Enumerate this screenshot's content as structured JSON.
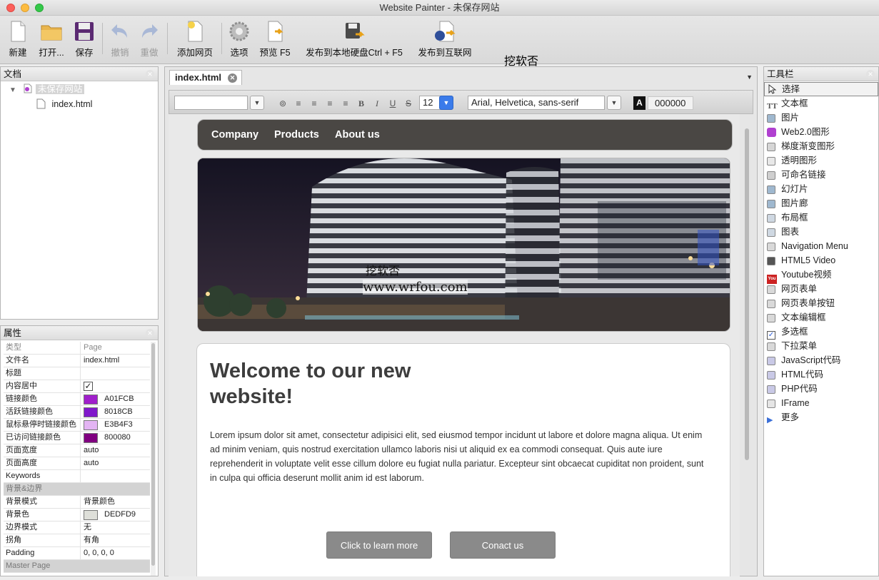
{
  "window": {
    "title": "Website Painter - 未保存网站"
  },
  "toolbar": [
    {
      "id": "new",
      "label": "新建",
      "icon": "new-file-icon",
      "disabled": false
    },
    {
      "id": "open",
      "label": "打开...",
      "icon": "folder-icon",
      "disabled": false
    },
    {
      "id": "save",
      "label": "保存",
      "icon": "floppy-disk-icon",
      "disabled": false
    },
    {
      "id": "undo",
      "label": "撤销",
      "icon": "undo-icon",
      "disabled": true
    },
    {
      "id": "redo",
      "label": "重做",
      "icon": "redo-icon",
      "disabled": true
    },
    {
      "id": "add-page",
      "label": "添加网页",
      "icon": "add-page-icon",
      "disabled": false
    },
    {
      "id": "options",
      "label": "选项",
      "icon": "gear-icon",
      "disabled": false
    },
    {
      "id": "preview",
      "label": "预览 F5",
      "icon": "preview-icon",
      "disabled": false
    },
    {
      "id": "publish-local",
      "label": "发布到本地硬盘Ctrl + F5",
      "icon": "publish-disk-icon",
      "disabled": false
    },
    {
      "id": "publish-web",
      "label": "发布到互联网",
      "icon": "publish-web-icon",
      "disabled": false
    }
  ],
  "documents": {
    "title": "文档",
    "site_name": "未保存网站",
    "pages": [
      "index.html"
    ]
  },
  "properties": {
    "title": "属性",
    "rows": [
      {
        "key": "类型",
        "value": "Page",
        "type": "dim"
      },
      {
        "key": "文件名",
        "value": "index.html",
        "type": "text"
      },
      {
        "key": "标题",
        "value": "",
        "type": "text"
      },
      {
        "key": "内容居中",
        "value": "✓",
        "type": "check"
      },
      {
        "key": "链接颜色",
        "value": "A01FCB",
        "type": "color",
        "color": "#A01FCB"
      },
      {
        "key": "活跃链接颜色",
        "value": "8018CB",
        "type": "color",
        "color": "#8018CB"
      },
      {
        "key": "鼠标悬停时链接颜色",
        "value": "E3B4F3",
        "type": "color",
        "color": "#E3B4F3"
      },
      {
        "key": "已访问链接颜色",
        "value": "800080",
        "type": "color",
        "color": "#800080"
      },
      {
        "key": "页面宽度",
        "value": "auto",
        "type": "text"
      },
      {
        "key": "页面高度",
        "value": "auto",
        "type": "text"
      },
      {
        "key": "Keywords",
        "value": "",
        "type": "text"
      },
      {
        "key": "背景&边界",
        "value": "",
        "type": "section"
      },
      {
        "key": "背景模式",
        "value": "背景颜色",
        "type": "text"
      },
      {
        "key": "背景色",
        "value": "DEDFD9",
        "type": "color",
        "color": "#DEDFD9"
      },
      {
        "key": "边界模式",
        "value": "无",
        "type": "text"
      },
      {
        "key": "拐角",
        "value": "有角",
        "type": "text"
      },
      {
        "key": "Padding",
        "value": "0, 0, 0, 0",
        "type": "text"
      },
      {
        "key": "Master Page",
        "value": "",
        "type": "section"
      }
    ]
  },
  "editor": {
    "tab_label": "index.html",
    "format_bar": {
      "font_size": "12",
      "font_family": "Arial, Helvetica, sans-serif",
      "color_value": "000000",
      "color_button_label": "A"
    }
  },
  "site": {
    "nav_items": [
      "Company",
      "Products",
      "About us"
    ],
    "heading": "Welcome to our new website!",
    "paragraph": "Lorem ipsum dolor sit amet, consectetur adipisici elit, sed eiusmod tempor incidunt ut labore et dolore magna aliqua. Ut enim ad minim veniam, quis nostrud exercitation ullamco laboris nisi ut aliquid ex ea commodi consequat. Quis aute iure reprehenderit in voluptate velit esse cillum dolore eu fugiat nulla pariatur. Excepteur sint obcaecat cupiditat non proident, sunt in culpa qui officia deserunt mollit anim id est laborum.",
    "buttons": [
      "Click to learn more",
      "Conact us"
    ]
  },
  "tools": {
    "title": "工具栏",
    "items": [
      {
        "label": "选择",
        "icon": "cursor-arrow-icon",
        "color": "#ffffff"
      },
      {
        "label": "文本框",
        "icon": "text-icon",
        "color": "#ffffff"
      },
      {
        "label": "图片",
        "icon": "image-icon",
        "color": "#9fb8cf"
      },
      {
        "label": "Web2.0图形",
        "icon": "web20-shape-icon",
        "color": "#b040d0"
      },
      {
        "label": "梯度渐变图形",
        "icon": "gradient-shape-icon",
        "color": "#d6d6d6"
      },
      {
        "label": "透明图形",
        "icon": "transparent-shape-icon",
        "color": "#e8e8e8"
      },
      {
        "label": "可命名链接",
        "icon": "anchor-link-icon",
        "color": "#cfcfcf"
      },
      {
        "label": "幻灯片",
        "icon": "slideshow-icon",
        "color": "#9fb8cf"
      },
      {
        "label": "图片廊",
        "icon": "gallery-icon",
        "color": "#9fb8cf"
      },
      {
        "label": "布局框",
        "icon": "layout-box-icon",
        "color": "#cfd8e2"
      },
      {
        "label": "图表",
        "icon": "table-icon",
        "color": "#cfd8e2"
      },
      {
        "label": "Navigation Menu",
        "icon": "navigation-menu-icon",
        "color": "#d9d9d9"
      },
      {
        "label": "HTML5 Video",
        "icon": "video-icon",
        "color": "#555555"
      },
      {
        "label": "Youtube视频",
        "icon": "youtube-icon",
        "color": "#cc2222"
      },
      {
        "label": "网页表单",
        "icon": "form-icon",
        "color": "#d9d9d9"
      },
      {
        "label": "网页表单按钮",
        "icon": "form-button-icon",
        "color": "#d9d9d9"
      },
      {
        "label": "文本编辑框",
        "icon": "text-input-icon",
        "color": "#d9d9d9"
      },
      {
        "label": "多选框",
        "icon": "checkbox-icon",
        "color": "#ffffff"
      },
      {
        "label": "下拉菜单",
        "icon": "dropdown-menu-icon",
        "color": "#d9d9d9"
      },
      {
        "label": "JavaScript代码",
        "icon": "javascript-icon",
        "color": "#c9c9e6"
      },
      {
        "label": "HTML代码",
        "icon": "html-code-icon",
        "color": "#c9c9e6"
      },
      {
        "label": "PHP代码",
        "icon": "php-code-icon",
        "color": "#c9c9e6"
      },
      {
        "label": "IFrame",
        "icon": "iframe-icon",
        "color": "#e5e5e5"
      },
      {
        "label": "更多",
        "icon": "more-arrow-icon",
        "color": "#3a6fd8"
      }
    ]
  },
  "watermark": {
    "line1": "挖软否",
    "line2": "www.wrfou.com"
  }
}
